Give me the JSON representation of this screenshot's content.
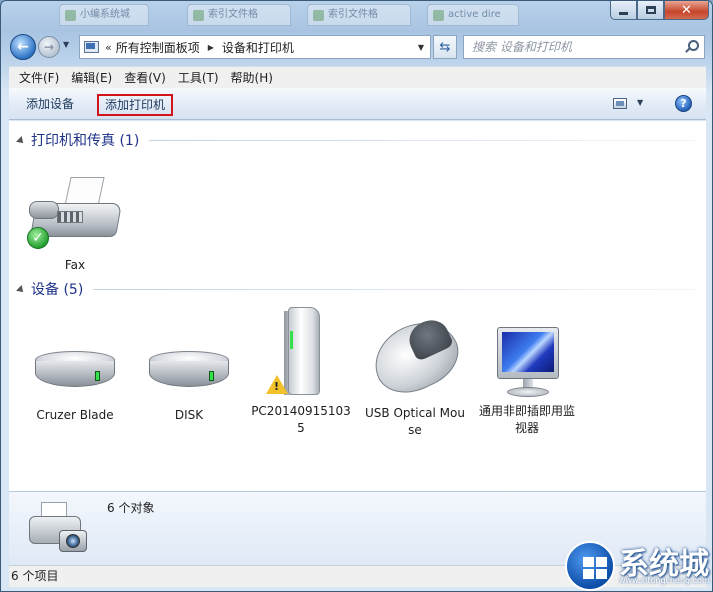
{
  "tabs": [
    "小编系统城",
    "索引文件格",
    "索引文件格",
    "active dire"
  ],
  "address": {
    "chevron": "«",
    "segments": [
      "所有控制面板项",
      "设备和打印机"
    ]
  },
  "search": {
    "placeholder": "搜索 设备和打印机"
  },
  "menu": [
    "文件(F)",
    "编辑(E)",
    "查看(V)",
    "工具(T)",
    "帮助(H)"
  ],
  "commands": {
    "add_device": "添加设备",
    "add_printer": "添加打印机"
  },
  "groups": {
    "printers": {
      "title": "打印机和传真 (1)",
      "items": [
        {
          "label": "Fax",
          "status": "default"
        }
      ]
    },
    "devices": {
      "title": "设备 (5)",
      "items": [
        {
          "label": "Cruzer Blade",
          "icon": "drive-icon"
        },
        {
          "label": "DISK",
          "icon": "drive-icon"
        },
        {
          "label": "PC201409151035",
          "icon": "external-disk-icon",
          "warning": true
        },
        {
          "label": "USB Optical Mouse",
          "icon": "mouse-icon"
        },
        {
          "label": "通用非即插即用监视器",
          "icon": "monitor-icon"
        }
      ]
    }
  },
  "details": {
    "count_text": "6 个对象"
  },
  "status": {
    "items_text": "6 个项目"
  },
  "watermark": {
    "text": "系统城",
    "url": "www.xitongcheng.com"
  },
  "colors": {
    "highlight_border": "#d4141b",
    "group_title": "#1e3287",
    "ok_green": "#1f9a2a",
    "led_green": "#36e04a"
  }
}
